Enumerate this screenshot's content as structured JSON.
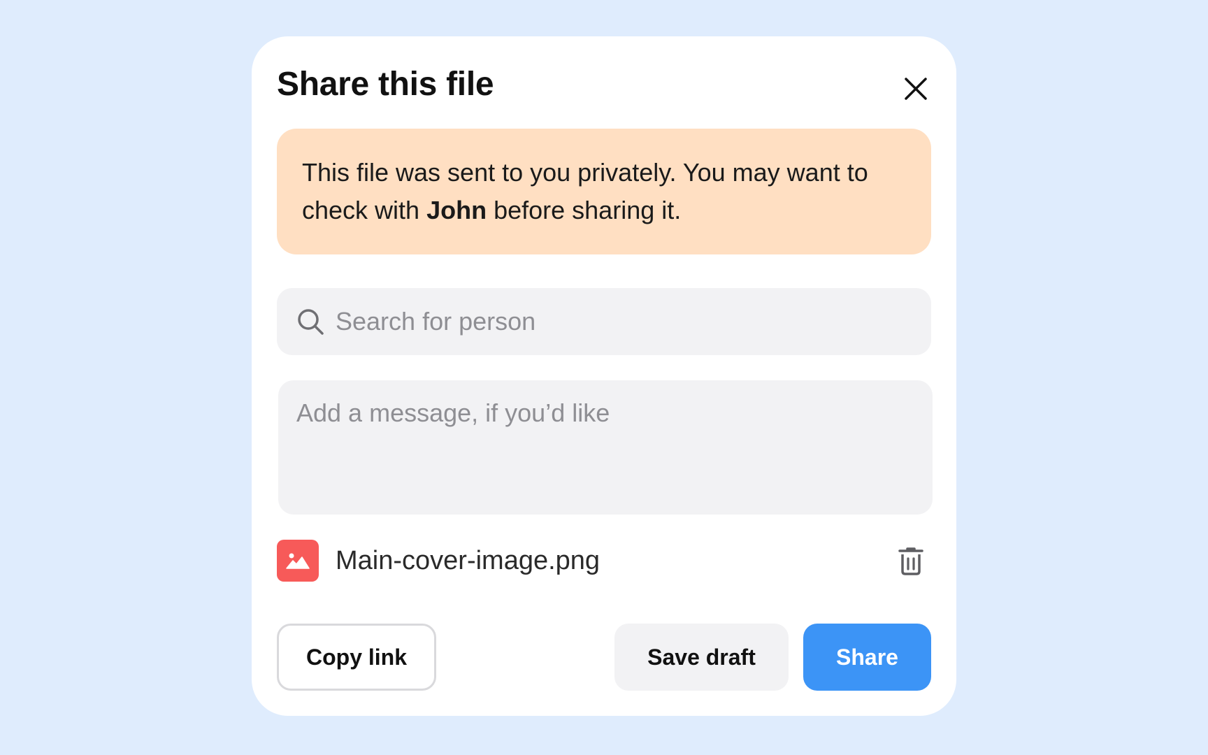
{
  "dialog": {
    "title": "Share this file",
    "close_icon": "close-icon"
  },
  "warning": {
    "text_before": "This file was sent to you privately. You may want to check with ",
    "sender_name": "John",
    "text_after": " before sharing it.",
    "background_color": "#ffdfc2"
  },
  "search": {
    "icon": "search-icon",
    "placeholder": "Search for person",
    "value": ""
  },
  "message": {
    "placeholder": "Add a message, if you’d like",
    "value": ""
  },
  "attachment": {
    "icon": "image-icon",
    "icon_color": "#f75a59",
    "file_name": "Main-cover-image.png",
    "delete_icon": "trash-icon"
  },
  "actions": {
    "copy_link_label": "Copy link",
    "save_draft_label": "Save draft",
    "share_label": "Share",
    "share_color": "#3c94f6"
  }
}
